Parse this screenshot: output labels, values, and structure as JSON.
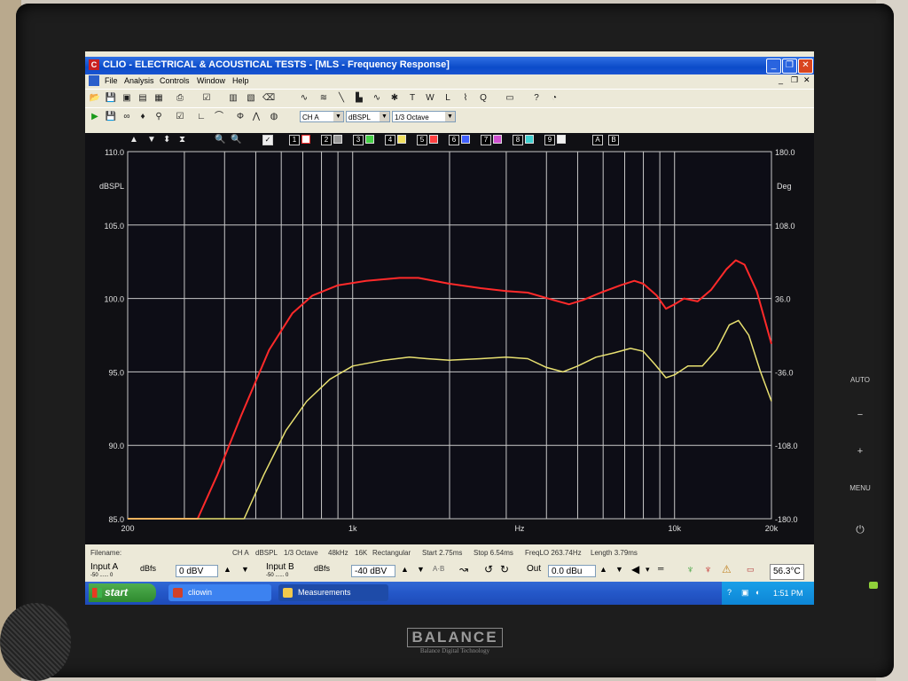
{
  "window": {
    "title": "CLIO - ELECTRICAL & ACOUSTICAL TESTS - [MLS - Frequency Response]",
    "app_icon": "C"
  },
  "menu": [
    "File",
    "Analysis",
    "Controls",
    "Window",
    "Help"
  ],
  "toolbar2": {
    "channel": "CH A",
    "unit": "dBSPL",
    "smoothing": "1/3 Octave"
  },
  "plot_toolbar": {
    "curves": [
      "1",
      "2",
      "3",
      "4",
      "5",
      "6",
      "7",
      "8",
      "9"
    ],
    "markers": [
      "A",
      "B"
    ]
  },
  "chart_data": {
    "type": "line",
    "title": "",
    "x_scale": "log",
    "xlim": [
      200,
      20000
    ],
    "x_ticks": [
      "200",
      "1k",
      "Hz",
      "10k",
      "20k"
    ],
    "ylim": [
      85,
      110
    ],
    "ylabel_left": "dBSPL",
    "y_ticks_left": [
      "110.0",
      "105.0",
      "100.0",
      "95.0",
      "90.0",
      "85.0"
    ],
    "ylabel_right": "Deg",
    "y_ticks_right": [
      "180.0",
      "108.0",
      "36.0",
      "-36.0",
      "-108.0",
      "-180.0"
    ],
    "grid": true,
    "series": [
      {
        "color": "#ff2a2a",
        "points": [
          [
            200,
            85
          ],
          [
            300,
            85
          ],
          [
            330,
            85
          ],
          [
            380,
            88
          ],
          [
            450,
            92
          ],
          [
            550,
            96.5
          ],
          [
            650,
            99
          ],
          [
            750,
            100.2
          ],
          [
            900,
            100.9
          ],
          [
            1100,
            101.2
          ],
          [
            1400,
            101.4
          ],
          [
            1600,
            101.4
          ],
          [
            2000,
            101.0
          ],
          [
            2500,
            100.7
          ],
          [
            3000,
            100.5
          ],
          [
            3500,
            100.4
          ],
          [
            4200,
            99.9
          ],
          [
            4700,
            99.6
          ],
          [
            5200,
            99.9
          ],
          [
            5900,
            100.4
          ],
          [
            6800,
            100.9
          ],
          [
            7500,
            101.2
          ],
          [
            8000,
            101.0
          ],
          [
            8800,
            100.2
          ],
          [
            9400,
            99.3
          ],
          [
            10000,
            99.6
          ],
          [
            10700,
            100.0
          ],
          [
            11800,
            99.8
          ],
          [
            13000,
            100.6
          ],
          [
            14500,
            102.0
          ],
          [
            15500,
            102.6
          ],
          [
            16500,
            102.3
          ],
          [
            18000,
            100.5
          ],
          [
            19200,
            98.3
          ],
          [
            20000,
            96.9
          ]
        ]
      },
      {
        "color": "#e8e070",
        "points": [
          [
            200,
            85
          ],
          [
            420,
            85
          ],
          [
            460,
            85
          ],
          [
            530,
            88
          ],
          [
            620,
            91
          ],
          [
            720,
            93
          ],
          [
            850,
            94.5
          ],
          [
            1000,
            95.4
          ],
          [
            1250,
            95.8
          ],
          [
            1500,
            96.0
          ],
          [
            1700,
            95.9
          ],
          [
            2000,
            95.8
          ],
          [
            2500,
            95.9
          ],
          [
            3000,
            96.0
          ],
          [
            3500,
            95.9
          ],
          [
            4000,
            95.3
          ],
          [
            4500,
            95.0
          ],
          [
            5000,
            95.4
          ],
          [
            5700,
            96.0
          ],
          [
            6500,
            96.3
          ],
          [
            7300,
            96.6
          ],
          [
            8000,
            96.4
          ],
          [
            8700,
            95.5
          ],
          [
            9400,
            94.6
          ],
          [
            10000,
            94.8
          ],
          [
            11000,
            95.4
          ],
          [
            12200,
            95.4
          ],
          [
            13500,
            96.5
          ],
          [
            14800,
            98.2
          ],
          [
            15800,
            98.5
          ],
          [
            17000,
            97.5
          ],
          [
            18500,
            95.0
          ],
          [
            20000,
            93.0
          ]
        ]
      }
    ]
  },
  "filename_row": {
    "label": "Filename:",
    "channel": "CH A",
    "unit": "dBSPL",
    "smoothing": "1/3 Octave",
    "rate": "48kHz",
    "size": "16K",
    "window": "Rectangular",
    "start": "Start 2.75ms",
    "stop": "Stop 6.54ms",
    "freqlo": "FreqLO 263.74Hz",
    "length": "Length 3.79ms"
  },
  "io": {
    "input_a_label": "Input A",
    "input_a_scale": "-50 ...... 0",
    "dbfs_a": "dBfs",
    "input_a_value": "0 dBV",
    "input_b_label": "Input B",
    "input_b_scale": "-50 ...... 0",
    "dbfs_b": "dBfs",
    "input_b_value": "-40 dBV",
    "out_label": "Out",
    "out_value": "0.0 dBu",
    "temperature": "56.3°C"
  },
  "taskbar": {
    "start": "start",
    "tasks": [
      "cliowin",
      "Measurements"
    ],
    "clock": "1:51 PM"
  },
  "monitor": {
    "brand": "BALANCE",
    "brand_sub": "Balance Digital Technology",
    "buttons": [
      "AUTO",
      "−",
      "+",
      "MENU"
    ]
  }
}
